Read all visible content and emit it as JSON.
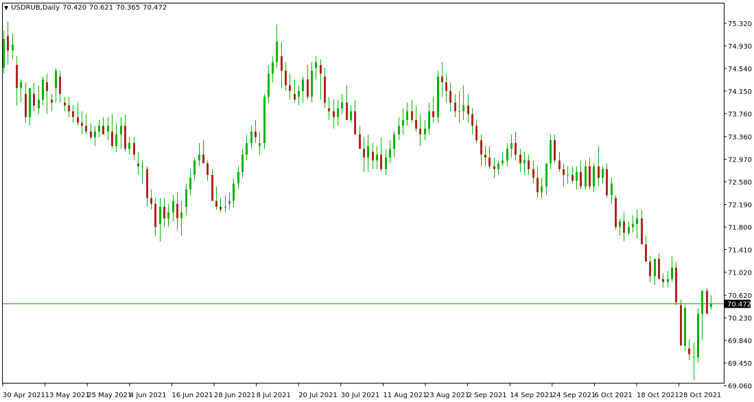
{
  "header": {
    "symbol": "USDRUB,Daily",
    "open": "70.420",
    "high": "70.621",
    "low": "70.365",
    "close": "70.472",
    "menu_icon": "triangle-down-icon"
  },
  "colors": {
    "bull": "#00b400",
    "bear": "#b22222",
    "price_line": "#00a000",
    "price_label_bg": "#000000",
    "price_label_fg": "#ffffff",
    "background": "#ffffff",
    "axis": "#000000"
  },
  "chart_data": {
    "type": "candlestick",
    "symbol": "USDRUB",
    "timeframe": "Daily",
    "ylim": [
      69.06,
      75.32
    ],
    "y_ticks": [
      "75.320",
      "74.930",
      "74.540",
      "74.150",
      "73.760",
      "73.360",
      "72.970",
      "72.580",
      "72.190",
      "71.800",
      "71.410",
      "71.020",
      "70.620",
      "70.230",
      "69.840",
      "69.450",
      "69.060"
    ],
    "x_ticks": [
      "30 Apr 2021",
      "13 May 2021",
      "25 May 2021",
      "4 Jun 2021",
      "16 Jun 2021",
      "28 Jun 2021",
      "8 Jul 2021",
      "20 Jul 2021",
      "30 Jul 2021",
      "11 Aug 2021",
      "23 Aug 2021",
      "2 Sep 2021",
      "14 Sep 2021",
      "24 Sep 2021",
      "6 Oct 2021",
      "18 Oct 2021",
      "28 Oct 2021"
    ],
    "current_price": "70.472",
    "candles": [
      [
        74.55,
        75.2,
        74.45,
        75.05
      ],
      [
        75.1,
        75.35,
        74.6,
        74.85
      ],
      [
        74.85,
        75.15,
        74.7,
        74.95
      ],
      [
        74.6,
        74.75,
        73.9,
        74.2
      ],
      [
        74.2,
        74.35,
        73.95,
        74.3
      ],
      [
        74.1,
        74.3,
        73.6,
        73.7
      ],
      [
        73.7,
        74.2,
        73.55,
        74.2
      ],
      [
        74.1,
        74.3,
        73.8,
        73.9
      ],
      [
        73.85,
        74.25,
        73.75,
        74.0
      ],
      [
        74.0,
        74.4,
        73.9,
        74.35
      ],
      [
        74.3,
        74.45,
        73.75,
        74.15
      ],
      [
        74.0,
        74.1,
        73.8,
        73.95
      ],
      [
        74.2,
        74.55,
        73.95,
        74.5
      ],
      [
        74.4,
        74.5,
        73.95,
        74.1
      ],
      [
        73.95,
        74.05,
        73.8,
        73.9
      ],
      [
        73.9,
        74.05,
        73.7,
        73.8
      ],
      [
        73.8,
        73.9,
        73.6,
        73.7
      ],
      [
        73.7,
        73.95,
        73.55,
        73.6
      ],
      [
        73.6,
        73.8,
        73.4,
        73.55
      ],
      [
        73.55,
        73.75,
        73.4,
        73.45
      ],
      [
        73.45,
        73.6,
        73.3,
        73.35
      ],
      [
        73.35,
        73.55,
        73.2,
        73.45
      ],
      [
        73.45,
        73.65,
        73.35,
        73.55
      ],
      [
        73.55,
        73.7,
        73.4,
        73.4
      ],
      [
        73.45,
        73.7,
        73.3,
        73.55
      ],
      [
        73.45,
        73.75,
        73.15,
        73.2
      ],
      [
        73.2,
        73.6,
        73.1,
        73.4
      ],
      [
        73.4,
        73.7,
        73.15,
        73.55
      ],
      [
        73.55,
        73.75,
        73.1,
        73.15
      ],
      [
        73.15,
        73.35,
        73.05,
        73.25
      ],
      [
        73.25,
        73.35,
        72.95,
        73.05
      ],
      [
        72.9,
        73.1,
        72.7,
        72.85
      ],
      [
        72.85,
        72.95,
        72.55,
        72.85
      ],
      [
        72.8,
        72.85,
        72.15,
        72.3
      ],
      [
        72.3,
        72.45,
        72.1,
        72.2
      ],
      [
        72.2,
        72.3,
        71.65,
        71.8
      ],
      [
        71.85,
        72.3,
        71.55,
        72.15
      ],
      [
        72.15,
        72.3,
        71.8,
        71.95
      ],
      [
        71.95,
        72.2,
        71.8,
        72.05
      ],
      [
        72.05,
        72.35,
        71.9,
        72.25
      ],
      [
        72.2,
        72.4,
        71.75,
        71.95
      ],
      [
        71.95,
        72.25,
        71.65,
        72.05
      ],
      [
        72.15,
        72.55,
        72.0,
        72.45
      ],
      [
        72.45,
        72.8,
        72.35,
        72.65
      ],
      [
        72.7,
        73.0,
        72.6,
        72.95
      ],
      [
        72.95,
        73.25,
        72.85,
        73.05
      ],
      [
        73.05,
        73.3,
        72.95,
        72.9
      ],
      [
        72.9,
        72.95,
        72.6,
        72.7
      ],
      [
        72.7,
        72.8,
        72.4,
        72.25
      ],
      [
        72.25,
        72.5,
        72.1,
        72.15
      ],
      [
        72.15,
        72.3,
        72.05,
        72.1
      ],
      [
        72.15,
        72.35,
        72.05,
        72.15
      ],
      [
        72.2,
        72.4,
        72.1,
        72.25
      ],
      [
        72.25,
        72.65,
        72.15,
        72.55
      ],
      [
        72.55,
        72.85,
        72.45,
        72.75
      ],
      [
        72.75,
        73.15,
        72.65,
        73.05
      ],
      [
        73.05,
        73.4,
        72.95,
        73.25
      ],
      [
        73.25,
        73.55,
        73.15,
        73.45
      ],
      [
        73.45,
        73.65,
        73.25,
        73.35
      ],
      [
        73.2,
        73.45,
        73.05,
        73.25
      ],
      [
        73.25,
        74.1,
        73.15,
        74.05
      ],
      [
        74.05,
        74.6,
        73.95,
        74.45
      ],
      [
        74.45,
        74.75,
        74.3,
        74.65
      ],
      [
        74.65,
        75.3,
        74.55,
        75.0
      ],
      [
        74.75,
        75.0,
        74.2,
        74.5
      ],
      [
        74.5,
        74.65,
        74.15,
        74.25
      ],
      [
        74.25,
        74.45,
        74.0,
        74.15
      ],
      [
        74.1,
        74.35,
        73.95,
        74.0
      ],
      [
        74.05,
        74.25,
        73.9,
        74.15
      ],
      [
        74.15,
        74.4,
        73.95,
        74.35
      ],
      [
        74.35,
        74.6,
        74.0,
        74.05
      ],
      [
        74.05,
        74.65,
        73.95,
        74.5
      ],
      [
        74.55,
        74.75,
        74.35,
        74.65
      ],
      [
        74.6,
        74.7,
        74.0,
        74.45
      ],
      [
        74.4,
        74.55,
        73.85,
        73.95
      ],
      [
        73.85,
        74.05,
        73.65,
        73.8
      ],
      [
        73.8,
        74.0,
        73.5,
        73.7
      ],
      [
        73.7,
        74.0,
        73.55,
        73.85
      ],
      [
        73.85,
        74.1,
        73.75,
        73.95
      ],
      [
        73.95,
        74.25,
        73.8,
        73.65
      ],
      [
        73.65,
        73.9,
        73.6,
        73.8
      ],
      [
        73.8,
        74.0,
        73.55,
        73.4
      ],
      [
        73.4,
        73.55,
        73.2,
        73.15
      ],
      [
        73.15,
        73.35,
        72.75,
        73.0
      ],
      [
        73.0,
        73.4,
        72.75,
        73.2
      ],
      [
        73.1,
        73.25,
        72.8,
        72.95
      ],
      [
        72.95,
        73.2,
        72.8,
        73.05
      ],
      [
        73.05,
        73.35,
        72.75,
        72.8
      ],
      [
        72.8,
        73.15,
        72.7,
        73.0
      ],
      [
        73.0,
        73.3,
        72.9,
        73.15
      ],
      [
        73.15,
        73.45,
        73.0,
        73.4
      ],
      [
        73.4,
        73.7,
        73.3,
        73.55
      ],
      [
        73.55,
        73.85,
        73.4,
        73.65
      ],
      [
        73.65,
        73.95,
        73.55,
        73.8
      ],
      [
        73.8,
        74.0,
        73.6,
        73.65
      ],
      [
        73.65,
        73.9,
        73.45,
        73.5
      ],
      [
        73.5,
        73.75,
        73.2,
        73.4
      ],
      [
        73.4,
        73.65,
        73.3,
        73.5
      ],
      [
        73.5,
        73.95,
        73.4,
        73.8
      ],
      [
        73.8,
        74.05,
        73.6,
        73.7
      ],
      [
        73.7,
        74.5,
        73.6,
        74.4
      ],
      [
        74.4,
        74.65,
        74.05,
        74.3
      ],
      [
        74.3,
        74.45,
        73.95,
        74.15
      ],
      [
        74.15,
        74.3,
        73.8,
        73.95
      ],
      [
        73.95,
        74.1,
        73.7,
        73.8
      ],
      [
        73.8,
        74.15,
        73.6,
        73.8
      ],
      [
        73.8,
        74.25,
        73.65,
        73.9
      ],
      [
        73.9,
        74.1,
        73.6,
        73.75
      ],
      [
        73.75,
        73.85,
        73.4,
        73.55
      ],
      [
        73.55,
        73.65,
        73.25,
        73.3
      ],
      [
        73.3,
        73.4,
        72.85,
        73.05
      ],
      [
        73.05,
        73.2,
        72.85,
        73.0
      ],
      [
        73.0,
        73.2,
        72.8,
        72.85
      ],
      [
        72.85,
        73.0,
        72.65,
        72.8
      ],
      [
        72.8,
        72.95,
        72.7,
        72.9
      ],
      [
        72.9,
        73.1,
        72.85,
        72.95
      ],
      [
        72.95,
        73.25,
        72.85,
        73.15
      ],
      [
        73.15,
        73.4,
        73.0,
        73.25
      ],
      [
        73.25,
        73.45,
        72.95,
        73.05
      ],
      [
        73.05,
        73.15,
        72.75,
        72.9
      ],
      [
        72.9,
        73.1,
        72.7,
        72.95
      ],
      [
        72.95,
        73.05,
        72.7,
        72.8
      ],
      [
        72.8,
        72.95,
        72.55,
        72.65
      ],
      [
        72.65,
        72.85,
        72.3,
        72.4
      ],
      [
        72.4,
        72.65,
        72.3,
        72.5
      ],
      [
        72.5,
        72.75,
        72.35,
        72.9
      ],
      [
        72.9,
        73.4,
        72.8,
        73.3
      ],
      [
        73.3,
        73.4,
        72.9,
        72.95
      ],
      [
        72.95,
        73.1,
        72.75,
        72.8
      ],
      [
        72.8,
        72.9,
        72.5,
        72.7
      ],
      [
        72.7,
        72.85,
        72.55,
        72.7
      ],
      [
        72.7,
        72.85,
        72.55,
        72.6
      ],
      [
        72.6,
        72.85,
        72.45,
        72.75
      ],
      [
        72.75,
        72.95,
        72.45,
        72.5
      ],
      [
        72.5,
        72.95,
        72.45,
        72.85
      ],
      [
        72.85,
        73.0,
        72.45,
        72.5
      ],
      [
        72.5,
        72.9,
        72.4,
        72.85
      ],
      [
        72.85,
        73.2,
        72.5,
        72.65
      ],
      [
        72.65,
        72.85,
        72.55,
        72.8
      ],
      [
        72.8,
        72.9,
        72.3,
        72.35
      ],
      [
        72.35,
        72.65,
        72.2,
        72.55
      ],
      [
        72.3,
        72.35,
        71.75,
        71.8
      ],
      [
        71.8,
        71.95,
        71.65,
        71.9
      ],
      [
        71.9,
        72.05,
        71.55,
        71.7
      ],
      [
        71.7,
        71.9,
        71.65,
        71.8
      ],
      [
        71.8,
        72.0,
        71.7,
        71.85
      ],
      [
        71.85,
        72.1,
        71.6,
        71.95
      ],
      [
        71.95,
        72.1,
        71.65,
        71.5
      ],
      [
        71.5,
        71.65,
        71.35,
        71.2
      ],
      [
        71.2,
        71.3,
        70.85,
        70.95
      ],
      [
        70.95,
        71.25,
        70.8,
        71.25
      ],
      [
        71.25,
        71.35,
        70.95,
        70.9
      ],
      [
        70.9,
        71.0,
        70.75,
        70.85
      ],
      [
        70.85,
        71.05,
        70.75,
        70.9
      ],
      [
        70.9,
        71.3,
        70.85,
        71.1
      ],
      [
        71.1,
        71.2,
        70.45,
        70.5
      ],
      [
        70.45,
        70.55,
        70.25,
        69.75
      ],
      [
        69.75,
        70.45,
        69.65,
        70.4
      ],
      [
        69.7,
        69.85,
        69.5,
        69.6
      ],
      [
        69.55,
        69.8,
        69.15,
        69.55
      ],
      [
        69.55,
        70.4,
        69.45,
        70.3
      ],
      [
        70.3,
        70.7,
        69.85,
        70.7
      ],
      [
        70.7,
        70.75,
        70.3,
        70.3
      ],
      [
        70.42,
        70.62,
        70.37,
        70.47
      ]
    ]
  }
}
